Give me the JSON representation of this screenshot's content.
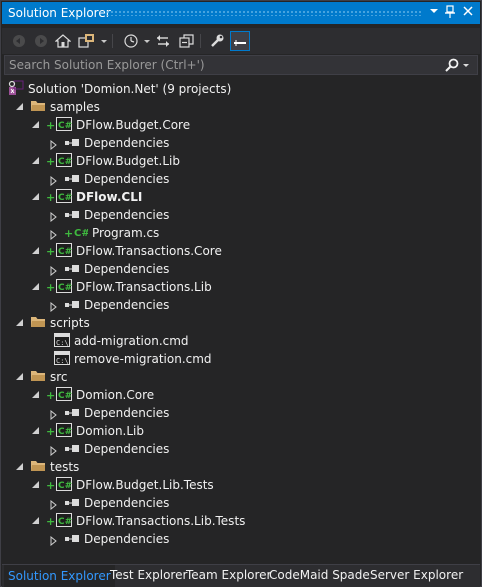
{
  "window": {
    "title": "Solution Explorer",
    "title_buttons": [
      "dropdown",
      "pin",
      "close"
    ]
  },
  "toolbar": {
    "icons": [
      "back-icon",
      "forward-icon",
      "home-icon",
      "switch-views-icon",
      "pending-changes-icon",
      "sync-icon",
      "collapse-all-icon",
      "properties-icon",
      "preview-icon"
    ]
  },
  "search": {
    "placeholder": "Search Solution Explorer (Ctrl+')"
  },
  "tree": {
    "solution": "Solution 'Domion.Net' (9 projects)",
    "nodes": [
      {
        "label": "samples",
        "type": "folder"
      },
      {
        "label": "DFlow.Budget.Core",
        "type": "project"
      },
      {
        "label": "Dependencies",
        "type": "dependencies"
      },
      {
        "label": "DFlow.Budget.Lib",
        "type": "project"
      },
      {
        "label": "Dependencies",
        "type": "dependencies"
      },
      {
        "label": "DFlow.CLI",
        "type": "project",
        "bold": true
      },
      {
        "label": "Dependencies",
        "type": "dependencies"
      },
      {
        "label": "Program.cs",
        "type": "csfile"
      },
      {
        "label": "DFlow.Transactions.Core",
        "type": "project"
      },
      {
        "label": "Dependencies",
        "type": "dependencies"
      },
      {
        "label": "DFlow.Transactions.Lib",
        "type": "project"
      },
      {
        "label": "Dependencies",
        "type": "dependencies"
      },
      {
        "label": "scripts",
        "type": "folder"
      },
      {
        "label": "add-migration.cmd",
        "type": "cmd"
      },
      {
        "label": "remove-migration.cmd",
        "type": "cmd"
      },
      {
        "label": "src",
        "type": "folder"
      },
      {
        "label": "Domion.Core",
        "type": "project"
      },
      {
        "label": "Dependencies",
        "type": "dependencies"
      },
      {
        "label": "Domion.Lib",
        "type": "project"
      },
      {
        "label": "Dependencies",
        "type": "dependencies"
      },
      {
        "label": "tests",
        "type": "folder"
      },
      {
        "label": "DFlow.Budget.Lib.Tests",
        "type": "project"
      },
      {
        "label": "Dependencies",
        "type": "dependencies"
      },
      {
        "label": "DFlow.Transactions.Lib.Tests",
        "type": "project"
      },
      {
        "label": "Dependencies",
        "type": "dependencies"
      }
    ]
  },
  "tabs": [
    {
      "label": "Solution Explorer",
      "active": true
    },
    {
      "label": "Test Explorer"
    },
    {
      "label": "Team Explorer"
    },
    {
      "label": "CodeMaid Spade"
    },
    {
      "label": "Server Explorer"
    }
  ],
  "colors": {
    "accent": "#007acc",
    "background": "#252526",
    "new_item_plus": "#3fb93f",
    "folder": "#dcb67a",
    "cs_project": "#3fb93f",
    "active_tab_text": "#3399ff"
  }
}
